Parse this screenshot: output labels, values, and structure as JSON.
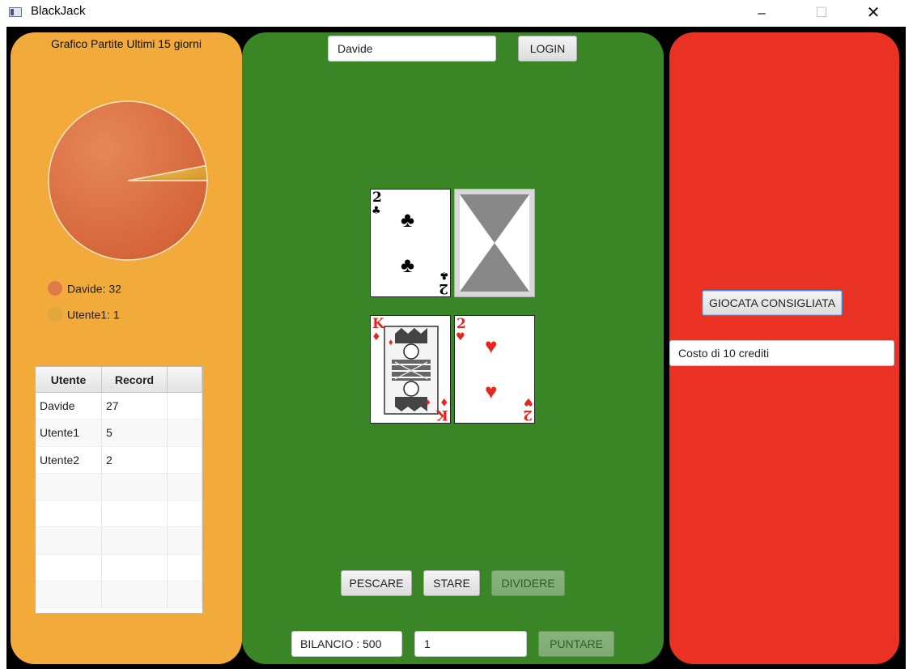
{
  "window": {
    "title": "BlackJack",
    "minimize": "–",
    "maximize": "☐",
    "close": "✕"
  },
  "stats": {
    "chart_title": "Grafico Partite Ultimi 15 giorni",
    "legend": [
      {
        "label": "Davide: 32",
        "color": "#e0794a"
      },
      {
        "label": "Utente1: 1",
        "color": "#e0a93e"
      }
    ],
    "table": {
      "headers": [
        "Utente",
        "Record",
        ""
      ],
      "rows": [
        [
          "Davide",
          "27",
          ""
        ],
        [
          "Utente1",
          "5",
          ""
        ],
        [
          "Utente2",
          "2",
          ""
        ],
        [
          "",
          "",
          ""
        ],
        [
          "",
          "",
          ""
        ],
        [
          "",
          "",
          ""
        ],
        [
          "",
          "",
          ""
        ],
        [
          "",
          "",
          ""
        ]
      ]
    }
  },
  "chart_data": {
    "type": "pie",
    "title": "Grafico Partite Ultimi 15 giorni",
    "labels": [
      "Davide",
      "Utente1"
    ],
    "values": [
      32,
      1
    ],
    "colors": [
      "#e0794a",
      "#e0a93e"
    ],
    "legend": "bottom-left"
  },
  "login": {
    "username": "Davide",
    "button": "LOGIN"
  },
  "dealer_cards": [
    {
      "rank": "2",
      "suit": "♣",
      "color": "black"
    },
    {
      "face_down": true
    }
  ],
  "player_cards": [
    {
      "rank": "K",
      "suit": "♦",
      "color": "red"
    },
    {
      "rank": "2",
      "suit": "♥",
      "color": "red"
    }
  ],
  "actions": {
    "draw": "PESCARE",
    "stand": "STARE",
    "split": "DIVIDERE"
  },
  "betting": {
    "balance": "BILANCIO : 500",
    "bet_value": "1",
    "bet_button": "PUNTARE"
  },
  "advice": {
    "button": "GIOCATA CONSIGLIATA",
    "cost": "Costo di 10 crediti"
  }
}
